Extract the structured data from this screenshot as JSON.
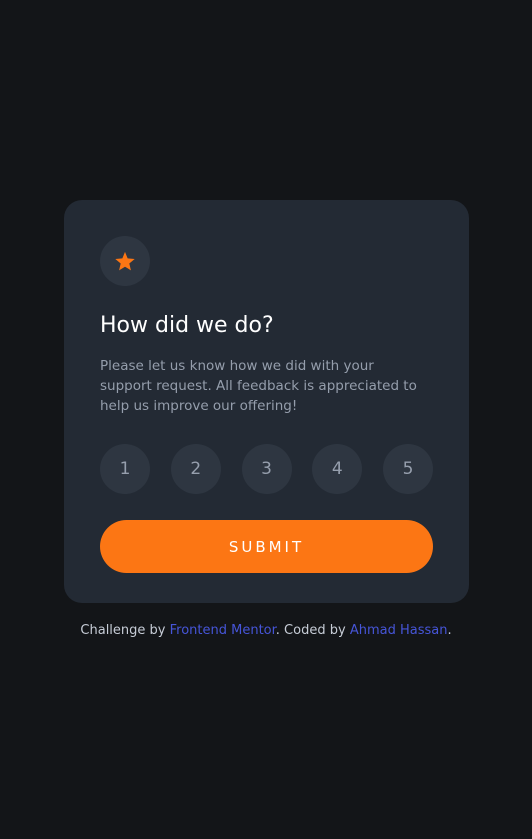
{
  "card": {
    "title": "How did we do?",
    "description": "Please let us know how we did with your support request. All feedback is appreciated to help us improve our offering!",
    "icon": "star-icon",
    "ratings": [
      "1",
      "2",
      "3",
      "4",
      "5"
    ],
    "submit_label": "SUBMIT"
  },
  "attribution": {
    "prefix": "Challenge by ",
    "mentor_link": "Frontend Mentor",
    "middle": ". Coded by ",
    "author_link": "Ahmad Hassan",
    "suffix": "."
  },
  "colors": {
    "background": "#131518",
    "card": "#232a34",
    "accent": "#fc7614",
    "link": "#4655d8"
  }
}
